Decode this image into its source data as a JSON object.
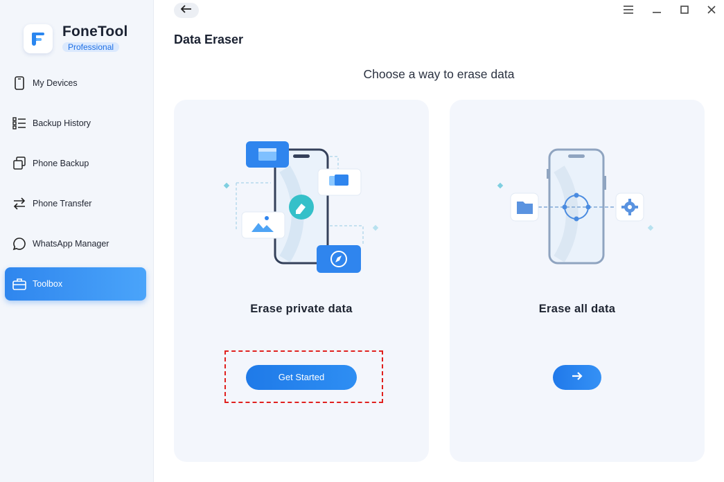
{
  "app": {
    "name": "FoneTool",
    "edition": "Professional"
  },
  "sidebar": {
    "items": [
      {
        "label": "My Devices",
        "icon": "phone-icon",
        "active": false
      },
      {
        "label": "Backup History",
        "icon": "list-icon",
        "active": false
      },
      {
        "label": "Phone Backup",
        "icon": "copy-icon",
        "active": false
      },
      {
        "label": "Phone Transfer",
        "icon": "transfer-arrows-icon",
        "active": false
      },
      {
        "label": "WhatsApp Manager",
        "icon": "chat-bubble-icon",
        "active": false
      },
      {
        "label": "Toolbox",
        "icon": "toolbox-icon",
        "active": true
      }
    ]
  },
  "header": {
    "title": "Data Eraser",
    "subtitle": "Choose a way to erase data"
  },
  "window_controls": [
    "menu-icon",
    "minimize-icon",
    "maximize-icon",
    "close-icon"
  ],
  "options": [
    {
      "title": "Erase private data",
      "button_label": "Get Started"
    },
    {
      "title": "Erase all data",
      "button_icon": "arrow-right-icon"
    }
  ],
  "colors": {
    "accent": "#2a86ef",
    "sidebar_bg": "#f3f6fb",
    "card_bg": "#f3f6fc",
    "highlight": "#e0201e"
  }
}
